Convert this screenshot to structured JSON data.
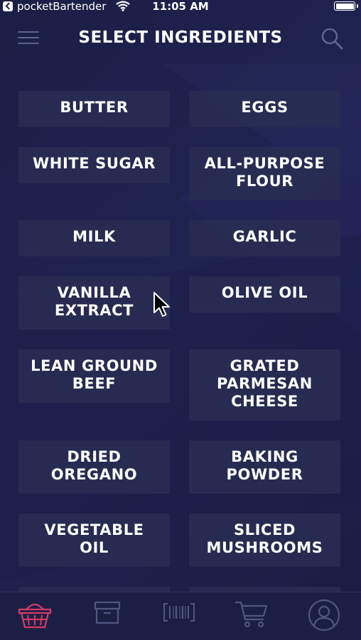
{
  "status_bar": {
    "app_name": "pocketBartender",
    "time": "11:05 AM"
  },
  "header": {
    "title": "SELECT INGREDIENTS",
    "menu_icon": "hamburger-menu-icon",
    "search_icon": "search-icon"
  },
  "ingredients": [
    "BUTTER",
    "EGGS",
    "WHITE SUGAR",
    "ALL-PURPOSE\nFLOUR",
    "MILK",
    "GARLIC",
    "VANILLA\nEXTRACT",
    "OLIVE OIL",
    "LEAN GROUND\nBEEF",
    "GRATED\nPARMESAN\nCHEESE",
    "DRIED\nOREGANO",
    "BAKING\nPOWDER",
    "VEGETABLE\nOIL",
    "SLICED\nMUSHROOMS"
  ],
  "tabs": [
    {
      "icon": "basket-icon",
      "active": true
    },
    {
      "icon": "pantry-box-icon",
      "active": false
    },
    {
      "icon": "barcode-scan-icon",
      "active": false
    },
    {
      "icon": "shopping-cart-icon",
      "active": false
    },
    {
      "icon": "user-profile-icon",
      "active": false
    }
  ],
  "colors": {
    "background": "#1d2049",
    "button": "#282c52",
    "active_tab": "#d63a66",
    "inactive_tab": "#4f5680"
  }
}
